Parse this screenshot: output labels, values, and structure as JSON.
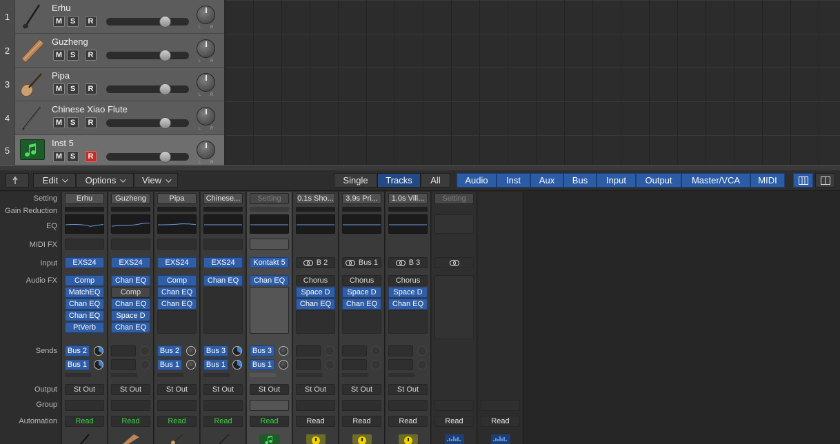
{
  "tracks": [
    {
      "num": "1",
      "name": "Erhu",
      "icon": "erhu-icon",
      "m": "M",
      "s": "S",
      "r": "R",
      "rec": false,
      "selected": false
    },
    {
      "num": "2",
      "name": "Guzheng",
      "icon": "guzheng-icon",
      "m": "M",
      "s": "S",
      "r": "R",
      "rec": false,
      "selected": false
    },
    {
      "num": "3",
      "name": "Pipa",
      "icon": "pipa-icon",
      "m": "M",
      "s": "S",
      "r": "R",
      "rec": false,
      "selected": false
    },
    {
      "num": "4",
      "name": "Chinese Xiao Flute",
      "icon": "flute-icon",
      "m": "M",
      "s": "S",
      "r": "R",
      "rec": false,
      "selected": false
    },
    {
      "num": "5",
      "name": "Inst 5",
      "icon": "music-note-icon",
      "m": "M",
      "s": "S",
      "r": "R",
      "rec": true,
      "selected": true
    }
  ],
  "pan_lr": {
    "l": "L",
    "r": "R"
  },
  "mixer_bar": {
    "edit": "Edit",
    "options": "Options",
    "view": "View",
    "views": [
      "Single",
      "Tracks",
      "All"
    ],
    "active_view": "Tracks",
    "filters": [
      "Audio",
      "Inst",
      "Aux",
      "Bus",
      "Input",
      "Output",
      "Master/VCA",
      "MIDI"
    ]
  },
  "row_labels": {
    "setting": "Setting",
    "gain_reduction": "Gain Reduction",
    "eq": "EQ",
    "midi_fx": "MIDI FX",
    "input": "Input",
    "audio_fx": "Audio FX",
    "sends": "Sends",
    "output": "Output",
    "group": "Group",
    "automation": "Automation"
  },
  "strips": [
    {
      "setting": "Erhu",
      "input": "EXS24",
      "fx": [
        "Comp",
        "MatchEQ",
        "Chan EQ",
        "Chan EQ",
        "PtVerb"
      ],
      "sends": [
        "Bus 2",
        "Bus 1"
      ],
      "output": "St Out",
      "automation": "Read",
      "icon": "erhu-icon"
    },
    {
      "setting": "Guzheng",
      "input": "EXS24",
      "fx": [
        "Chan EQ",
        "Comp",
        "Chan EQ",
        "Space D",
        "Chan EQ"
      ],
      "sends": [],
      "output": "St Out",
      "automation": "Read",
      "icon": "guzheng-icon"
    },
    {
      "setting": "Pipa",
      "input": "EXS24",
      "fx": [
        "Comp",
        "Chan EQ",
        "Chan EQ"
      ],
      "sends": [
        "Bus 2",
        "Bus 1"
      ],
      "output": "St Out",
      "automation": "Read",
      "icon": "pipa-icon"
    },
    {
      "setting": "Chinese...",
      "input": "EXS24",
      "fx": [
        "Chan EQ"
      ],
      "sends": [
        "Bus 3",
        "Bus 1"
      ],
      "output": "St Out",
      "automation": "Read",
      "icon": "flute-icon"
    },
    {
      "setting": "Setting",
      "input": "Kontakt 5",
      "fx": [
        "Chan EQ"
      ],
      "sends": [
        "Bus 3",
        "Bus 1"
      ],
      "output": "St Out",
      "automation": "Read",
      "icon": "music-note-icon"
    },
    {
      "setting": "0.1s Sho...",
      "input": "B 2",
      "fx": [
        "Chorus",
        "Space D",
        "Chan EQ"
      ],
      "sends": [],
      "output": "St Out",
      "automation": "Read",
      "icon": "aux-icon"
    },
    {
      "setting": "3.9s Pri...",
      "input": "Bus 1",
      "fx": [
        "Chorus",
        "Space D",
        "Chan EQ"
      ],
      "sends": [],
      "output": "St Out",
      "automation": "Read",
      "icon": "aux-icon"
    },
    {
      "setting": "1.0s Vill...",
      "input": "B 3",
      "fx": [
        "Chorus",
        "Space D",
        "Chan EQ"
      ],
      "sends": [],
      "output": "St Out",
      "automation": "Read",
      "icon": "aux-icon"
    },
    {
      "setting": "Setting",
      "input": "",
      "fx": [],
      "sends": [],
      "output": "",
      "automation": "Read",
      "icon": "waveform-icon"
    },
    {
      "setting": "",
      "input": "",
      "fx": [],
      "sends": [],
      "output": "",
      "automation": "Read",
      "icon": "waveform-icon"
    }
  ],
  "colors": {
    "plugin_blue": "#2f5da6",
    "record_red": "#c0302b",
    "read_green": "#37d33f"
  }
}
